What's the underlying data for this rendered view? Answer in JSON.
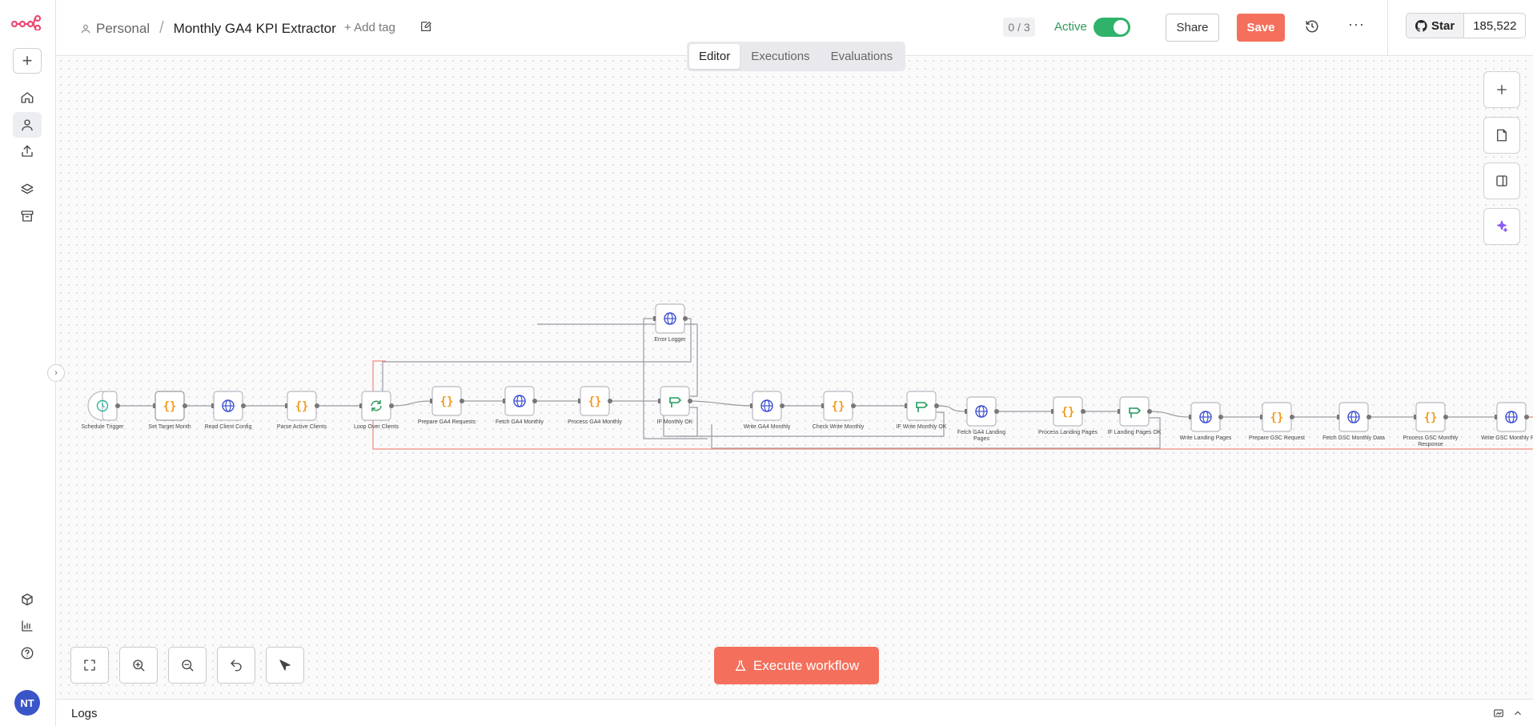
{
  "breadcrumb": {
    "owner": "Personal",
    "separator": "/",
    "workflow_title": "Monthly GA4 KPI Extractor"
  },
  "header": {
    "add_tag": "+ Add tag",
    "counter": "0 / 3",
    "active_label": "Active",
    "active": true,
    "share_label": "Share",
    "save_label": "Save",
    "more_label": "···",
    "github_star_label": "Star",
    "github_star_count": "185,522"
  },
  "tabs": [
    {
      "label": "Editor",
      "selected": true
    },
    {
      "label": "Executions",
      "selected": false
    },
    {
      "label": "Evaluations",
      "selected": false
    }
  ],
  "sidebar": {
    "items": [
      "add-icon",
      "home-icon",
      "user-icon",
      "share-icon",
      "layers-icon",
      "archive-icon",
      "cube-icon",
      "chart-icon",
      "help-icon"
    ],
    "avatar_initials": "NT"
  },
  "nodes": [
    {
      "label": "Schedule Trigger",
      "icon": "clock-icon"
    },
    {
      "label": "Set Target Month",
      "icon": "code-icon"
    },
    {
      "label": "Read Client Config",
      "icon": "globe-icon"
    },
    {
      "label": "Parse Active Clients",
      "icon": "code-icon"
    },
    {
      "label": "Loop Over Clients",
      "icon": "loop-icon"
    },
    {
      "label": "Prepare GA4 Requests",
      "icon": "code-icon"
    },
    {
      "label": "Fetch GA4 Monthly",
      "icon": "globe-icon"
    },
    {
      "label": "Process GA4 Monthly",
      "icon": "code-icon"
    },
    {
      "label": "Error Logger",
      "icon": "globe-icon"
    },
    {
      "label": "IF Monthly OK",
      "icon": "if-icon"
    },
    {
      "label": "Write GA4 Monthly",
      "icon": "globe-icon"
    },
    {
      "label": "Check Write Monthly",
      "icon": "code-icon"
    },
    {
      "label": "IF Write Monthly OK",
      "icon": "if-icon"
    },
    {
      "label": "Fetch GA4 Landing Pages",
      "icon": "globe-icon"
    },
    {
      "label": "Process Landing Pages",
      "icon": "code-icon"
    },
    {
      "label": "IF Landing Pages OK",
      "icon": "if-icon"
    },
    {
      "label": "Write Landing Pages",
      "icon": "globe-icon"
    },
    {
      "label": "Prepare GSC Request",
      "icon": "code-icon"
    },
    {
      "label": "Fetch GSC Monthly Data",
      "icon": "globe-icon"
    },
    {
      "label": "Process GSC Monthly Response",
      "icon": "code-icon"
    },
    {
      "label": "Write GSC Monthly Row",
      "icon": "globe-icon"
    }
  ],
  "right_tools": [
    "plus-icon",
    "sticky-note-icon",
    "panel-icon",
    "sparkle-icon"
  ],
  "bottom_tools": [
    "fit-view-icon",
    "zoom-in-icon",
    "zoom-out-icon",
    "undo-icon",
    "tidy-up-icon"
  ],
  "execute_label": "Execute workflow",
  "logs_label": "Logs",
  "colors": {
    "accent": "#f4705c",
    "active_green": "#2fb36a",
    "code_orange": "#f39a1f",
    "globe_blue": "#3c4fd1",
    "if_green": "#1f9b5a",
    "loop_green": "#2c9c5a"
  }
}
